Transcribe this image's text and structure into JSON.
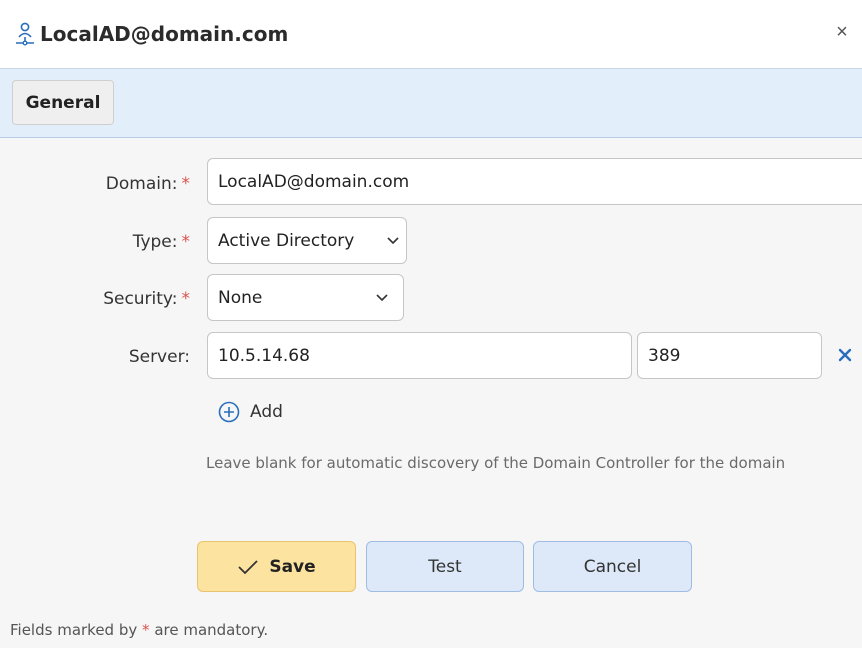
{
  "dialog": {
    "title": "LocalAD@domain.com",
    "close_label": "×"
  },
  "tabs": [
    {
      "label": "General"
    }
  ],
  "form": {
    "domain": {
      "label": "Domain:",
      "required_mark": "*",
      "value": "LocalAD@domain.com"
    },
    "type": {
      "label": "Type:",
      "required_mark": "*",
      "value": "Active Directory"
    },
    "security": {
      "label": "Security:",
      "required_mark": "*",
      "value": "None"
    },
    "server": {
      "label": "Server:",
      "host": "10.5.14.68",
      "port": "389"
    },
    "add_label": "Add",
    "hint": "Leave blank for automatic discovery of the Domain Controller for the domain"
  },
  "buttons": {
    "save": "Save",
    "test": "Test",
    "cancel": "Cancel"
  },
  "footer": {
    "prefix": "Fields marked by",
    "mark": "*",
    "suffix": "are mandatory."
  },
  "colors": {
    "accent": "#2a6ebb",
    "required": "#d9534f",
    "save_bg": "#fde3a0",
    "button_bg": "#dde9f9"
  },
  "icons": {
    "title": "network-user-icon",
    "close": "close-icon",
    "dropdown": "chevron-down-icon",
    "remove": "remove-icon",
    "add": "plus-circle-icon",
    "save": "checkmark-icon"
  }
}
